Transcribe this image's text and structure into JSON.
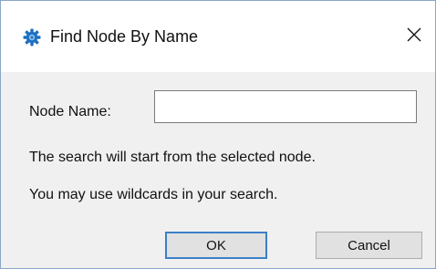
{
  "window": {
    "title": "Find Node By Name",
    "icon": "gear-icon",
    "close_icon": "close-icon"
  },
  "form": {
    "node_name_label": "Node Name:",
    "node_name_value": "",
    "node_name_placeholder": ""
  },
  "info": {
    "line1": "The search will start from the selected node.",
    "line2": "You may use wildcards in your search."
  },
  "buttons": {
    "ok_label": "OK",
    "cancel_label": "Cancel"
  },
  "colors": {
    "accent": "#3c7fc8",
    "icon_blue": "#1f6fc0",
    "panel_bg": "#f0f0f0"
  }
}
